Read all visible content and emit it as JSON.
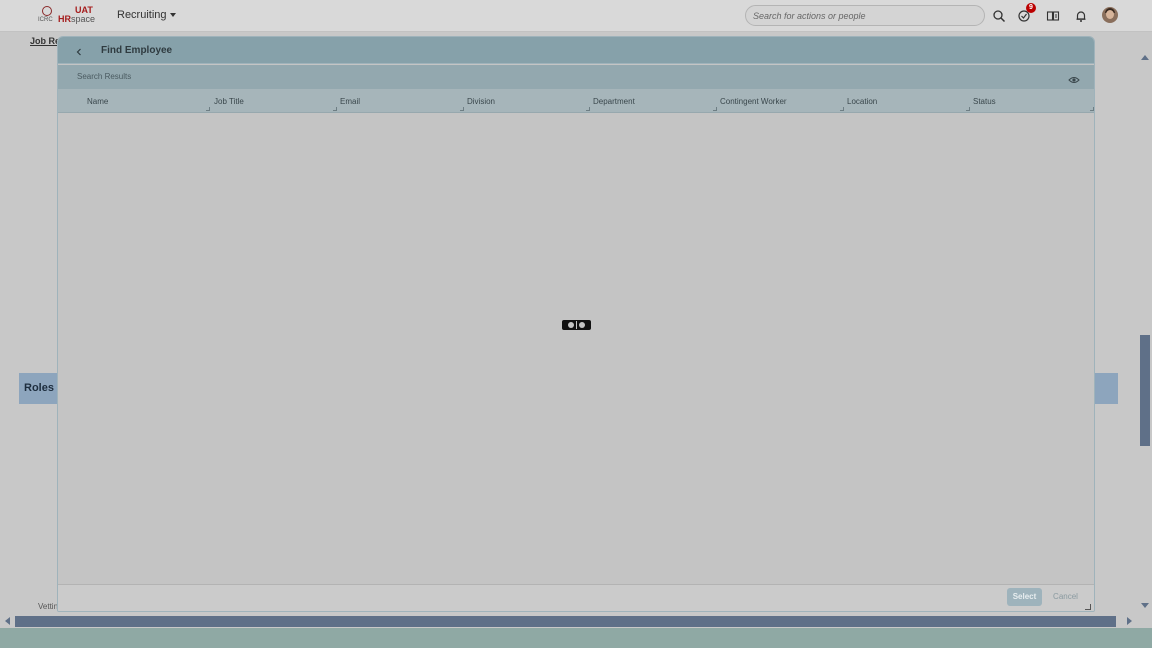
{
  "shell": {
    "logo": {
      "org": "ICRC",
      "brand_prefix": "HR",
      "brand_suffix": "space",
      "env": "UAT"
    },
    "app_menu_label": "Recruiting",
    "search_placeholder": "Search for actions or people",
    "notifications_badge": "9",
    "icons": [
      "search-icon",
      "todo-icon",
      "reading-icon",
      "bell-icon"
    ]
  },
  "background_page": {
    "link_label": "Job Re",
    "section_label": "Roles",
    "vetting_label": "Vettin"
  },
  "dialog": {
    "title": "Find Employee",
    "subheader": "Search Results",
    "columns": [
      "Name",
      "Job Title",
      "Email",
      "Division",
      "Department",
      "Contingent Worker",
      "Location",
      "Status"
    ],
    "rows": [],
    "loading": true,
    "buttons": {
      "select": "Select",
      "cancel": "Cancel"
    }
  },
  "colors": {
    "dialog_header": "#86a1aa",
    "section_band": "#8da5bd",
    "scroll_thumb": "#5f7088",
    "badge": "#bb0000"
  }
}
